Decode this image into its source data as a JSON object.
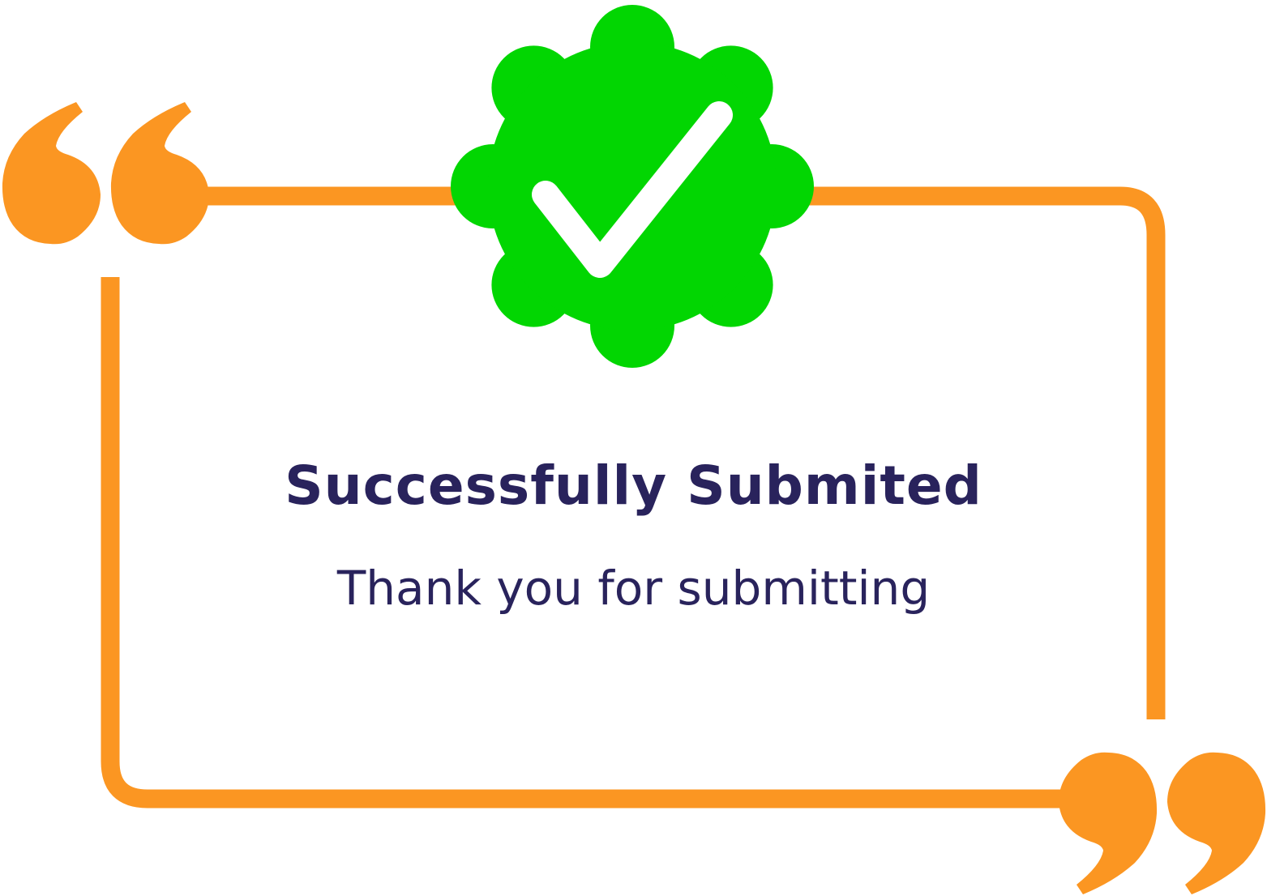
{
  "message": {
    "title": "Successfully Submited",
    "subtitle": "Thank you for submitting"
  },
  "icons": {
    "badge": "check-badge-icon",
    "open_quote": "open-quote-icon",
    "close_quote": "close-quote-icon"
  },
  "colors": {
    "frame": "#fb9622",
    "badge": "#02d602",
    "check": "#ffffff",
    "text": "#29235c",
    "background": "#ffffff"
  }
}
